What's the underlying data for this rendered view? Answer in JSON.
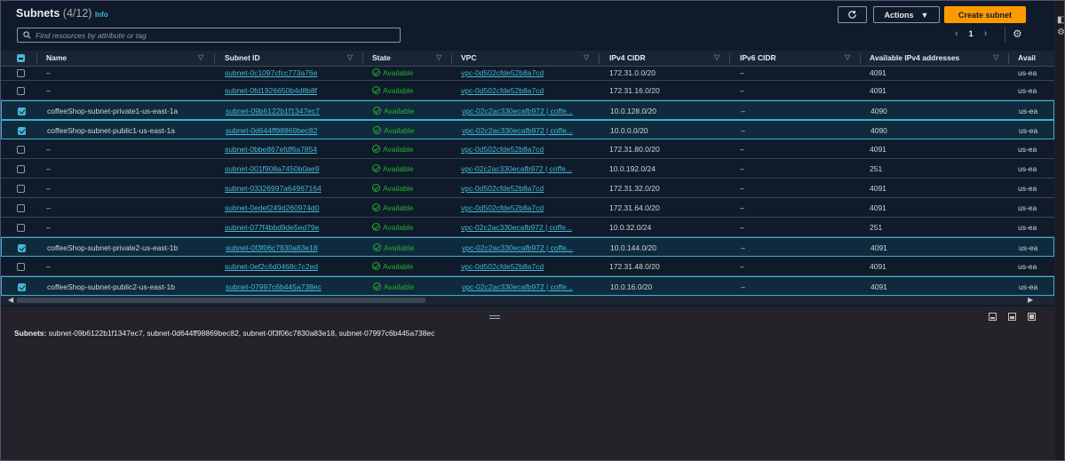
{
  "header": {
    "title": "Subnets",
    "count": "(4/12)",
    "info": "Info",
    "actions_label": "Actions",
    "create_label": "Create subnet"
  },
  "search": {
    "placeholder": "Find resources by attribute or tag"
  },
  "pagination": {
    "page": "1"
  },
  "columns": [
    "Name",
    "Subnet ID",
    "State",
    "VPC",
    "IPv4 CIDR",
    "IPv6 CIDR",
    "Available IPv4 addresses",
    "Avail"
  ],
  "rows": [
    {
      "selected": false,
      "name": "–",
      "subnet_id": "subnet-0c1097cfcc773a76e",
      "state": "Available",
      "vpc": "vpc-0d502cfde52b8a7cd",
      "ipv4": "172.31.0.0/20",
      "ipv6": "–",
      "avail_ips": "4091",
      "az": "us-ea"
    },
    {
      "selected": false,
      "name": "–",
      "subnet_id": "subnet-0fd1926650b4d8b8f",
      "state": "Available",
      "vpc": "vpc-0d502cfde52b8a7cd",
      "ipv4": "172.31.16.0/20",
      "ipv6": "–",
      "avail_ips": "4091",
      "az": "us-ea"
    },
    {
      "selected": true,
      "name": "coffeeShop-subnet-private1-us-east-1a",
      "subnet_id": "subnet-09b6122b1f1347ec7",
      "state": "Available",
      "vpc": "vpc-02c2ac330ecafb972 | coffe...",
      "ipv4": "10.0.128.0/20",
      "ipv6": "–",
      "avail_ips": "4090",
      "az": "us-ea"
    },
    {
      "selected": true,
      "name": "coffeeShop-subnet-public1-us-east-1a",
      "subnet_id": "subnet-0d644ff98869bec82",
      "state": "Available",
      "vpc": "vpc-02c2ac330ecafb972 | coffe...",
      "ipv4": "10.0.0.0/20",
      "ipv6": "–",
      "avail_ips": "4090",
      "az": "us-ea"
    },
    {
      "selected": false,
      "name": "–",
      "subnet_id": "subnet-0bbe867efdf6a7854",
      "state": "Available",
      "vpc": "vpc-0d502cfde52b8a7cd",
      "ipv4": "172.31.80.0/20",
      "ipv6": "–",
      "avail_ips": "4091",
      "az": "us-ea"
    },
    {
      "selected": false,
      "name": "–",
      "subnet_id": "subnet-001f908a7450b0ae9",
      "state": "Available",
      "vpc": "vpc-02c2ac330ecafb972 | coffe...",
      "ipv4": "10.0.192.0/24",
      "ipv6": "–",
      "avail_ips": "251",
      "az": "us-ea"
    },
    {
      "selected": false,
      "name": "–",
      "subnet_id": "subnet-03326997a64967164",
      "state": "Available",
      "vpc": "vpc-0d502cfde52b8a7cd",
      "ipv4": "172.31.32.0/20",
      "ipv6": "–",
      "avail_ips": "4091",
      "az": "us-ea"
    },
    {
      "selected": false,
      "name": "–",
      "subnet_id": "subnet-0edef249d260974d0",
      "state": "Available",
      "vpc": "vpc-0d502cfde52b8a7cd",
      "ipv4": "172.31.64.0/20",
      "ipv6": "–",
      "avail_ips": "4091",
      "az": "us-ea"
    },
    {
      "selected": false,
      "name": "–",
      "subnet_id": "subnet-077f4bbd9de5ed79e",
      "state": "Available",
      "vpc": "vpc-02c2ac330ecafb972 | coffe...",
      "ipv4": "10.0.32.0/24",
      "ipv6": "–",
      "avail_ips": "251",
      "az": "us-ea"
    },
    {
      "selected": true,
      "name": "coffeeShop-subnet-private2-us-east-1b",
      "subnet_id": "subnet-0f3f06c7830a83e18",
      "state": "Available",
      "vpc": "vpc-02c2ac330ecafb972 | coffe...",
      "ipv4": "10.0.144.0/20",
      "ipv6": "–",
      "avail_ips": "4091",
      "az": "us-ea"
    },
    {
      "selected": false,
      "name": "–",
      "subnet_id": "subnet-0ef2c6d0468c7c2ed",
      "state": "Available",
      "vpc": "vpc-0d502cfde52b8a7cd",
      "ipv4": "172.31.48.0/20",
      "ipv6": "–",
      "avail_ips": "4091",
      "az": "us-ea"
    },
    {
      "selected": true,
      "name": "coffeeShop-subnet-public2-us-east-1b",
      "subnet_id": "subnet-07997c6b445a738ec",
      "state": "Available",
      "vpc": "vpc-02c2ac330ecafb972 | coffe...",
      "ipv4": "10.0.16.0/20",
      "ipv6": "–",
      "avail_ips": "4091",
      "az": "us-ea"
    }
  ],
  "detail": {
    "label": "Subnets:",
    "value": "subnet-09b6122b1f1347ec7, subnet-0d644ff98869bec82, subnet-0f3f06c7830a83e18, subnet-07997c6b445a738ec"
  },
  "colors": {
    "accent": "#44b9d6",
    "primary": "#ff9900",
    "available": "#29ad32",
    "background": "#0f1b2a"
  },
  "icons": {
    "refresh": "refresh-icon",
    "search": "search-icon",
    "settings": "gear-icon",
    "available": "check-circle-icon"
  }
}
